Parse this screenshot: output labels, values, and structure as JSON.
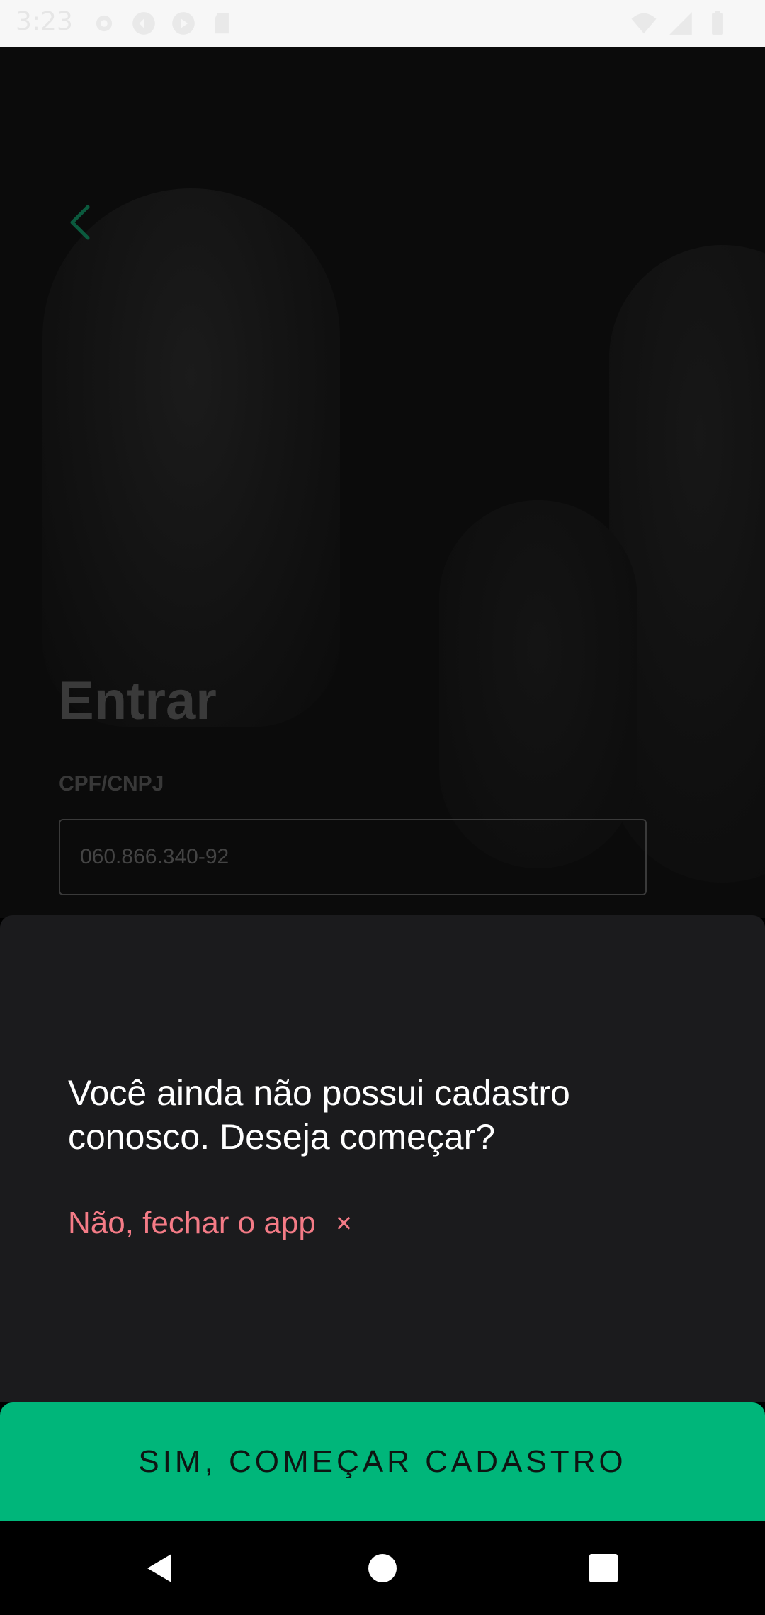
{
  "status_bar": {
    "time": "3:23",
    "left_icons": [
      "settings-icon",
      "sync-icon",
      "play-icon",
      "sd-card-icon"
    ],
    "right_icons": [
      "wifi-icon",
      "signal-icon",
      "battery-icon"
    ]
  },
  "login": {
    "title": "Entrar",
    "field_label": "CPF/CNPJ",
    "field_value": "060.866.340-92"
  },
  "sheet": {
    "message": "Você ainda não possui cadastro conosco. Deseja começar?",
    "close_label": "Não, fechar o app",
    "close_symbol": "×"
  },
  "cta": {
    "label": "SIM, COMEÇAR CADASTRO"
  },
  "colors": {
    "accent": "#00b67a",
    "danger": "#f47b86",
    "sheet_bg": "#1b1b1d"
  }
}
